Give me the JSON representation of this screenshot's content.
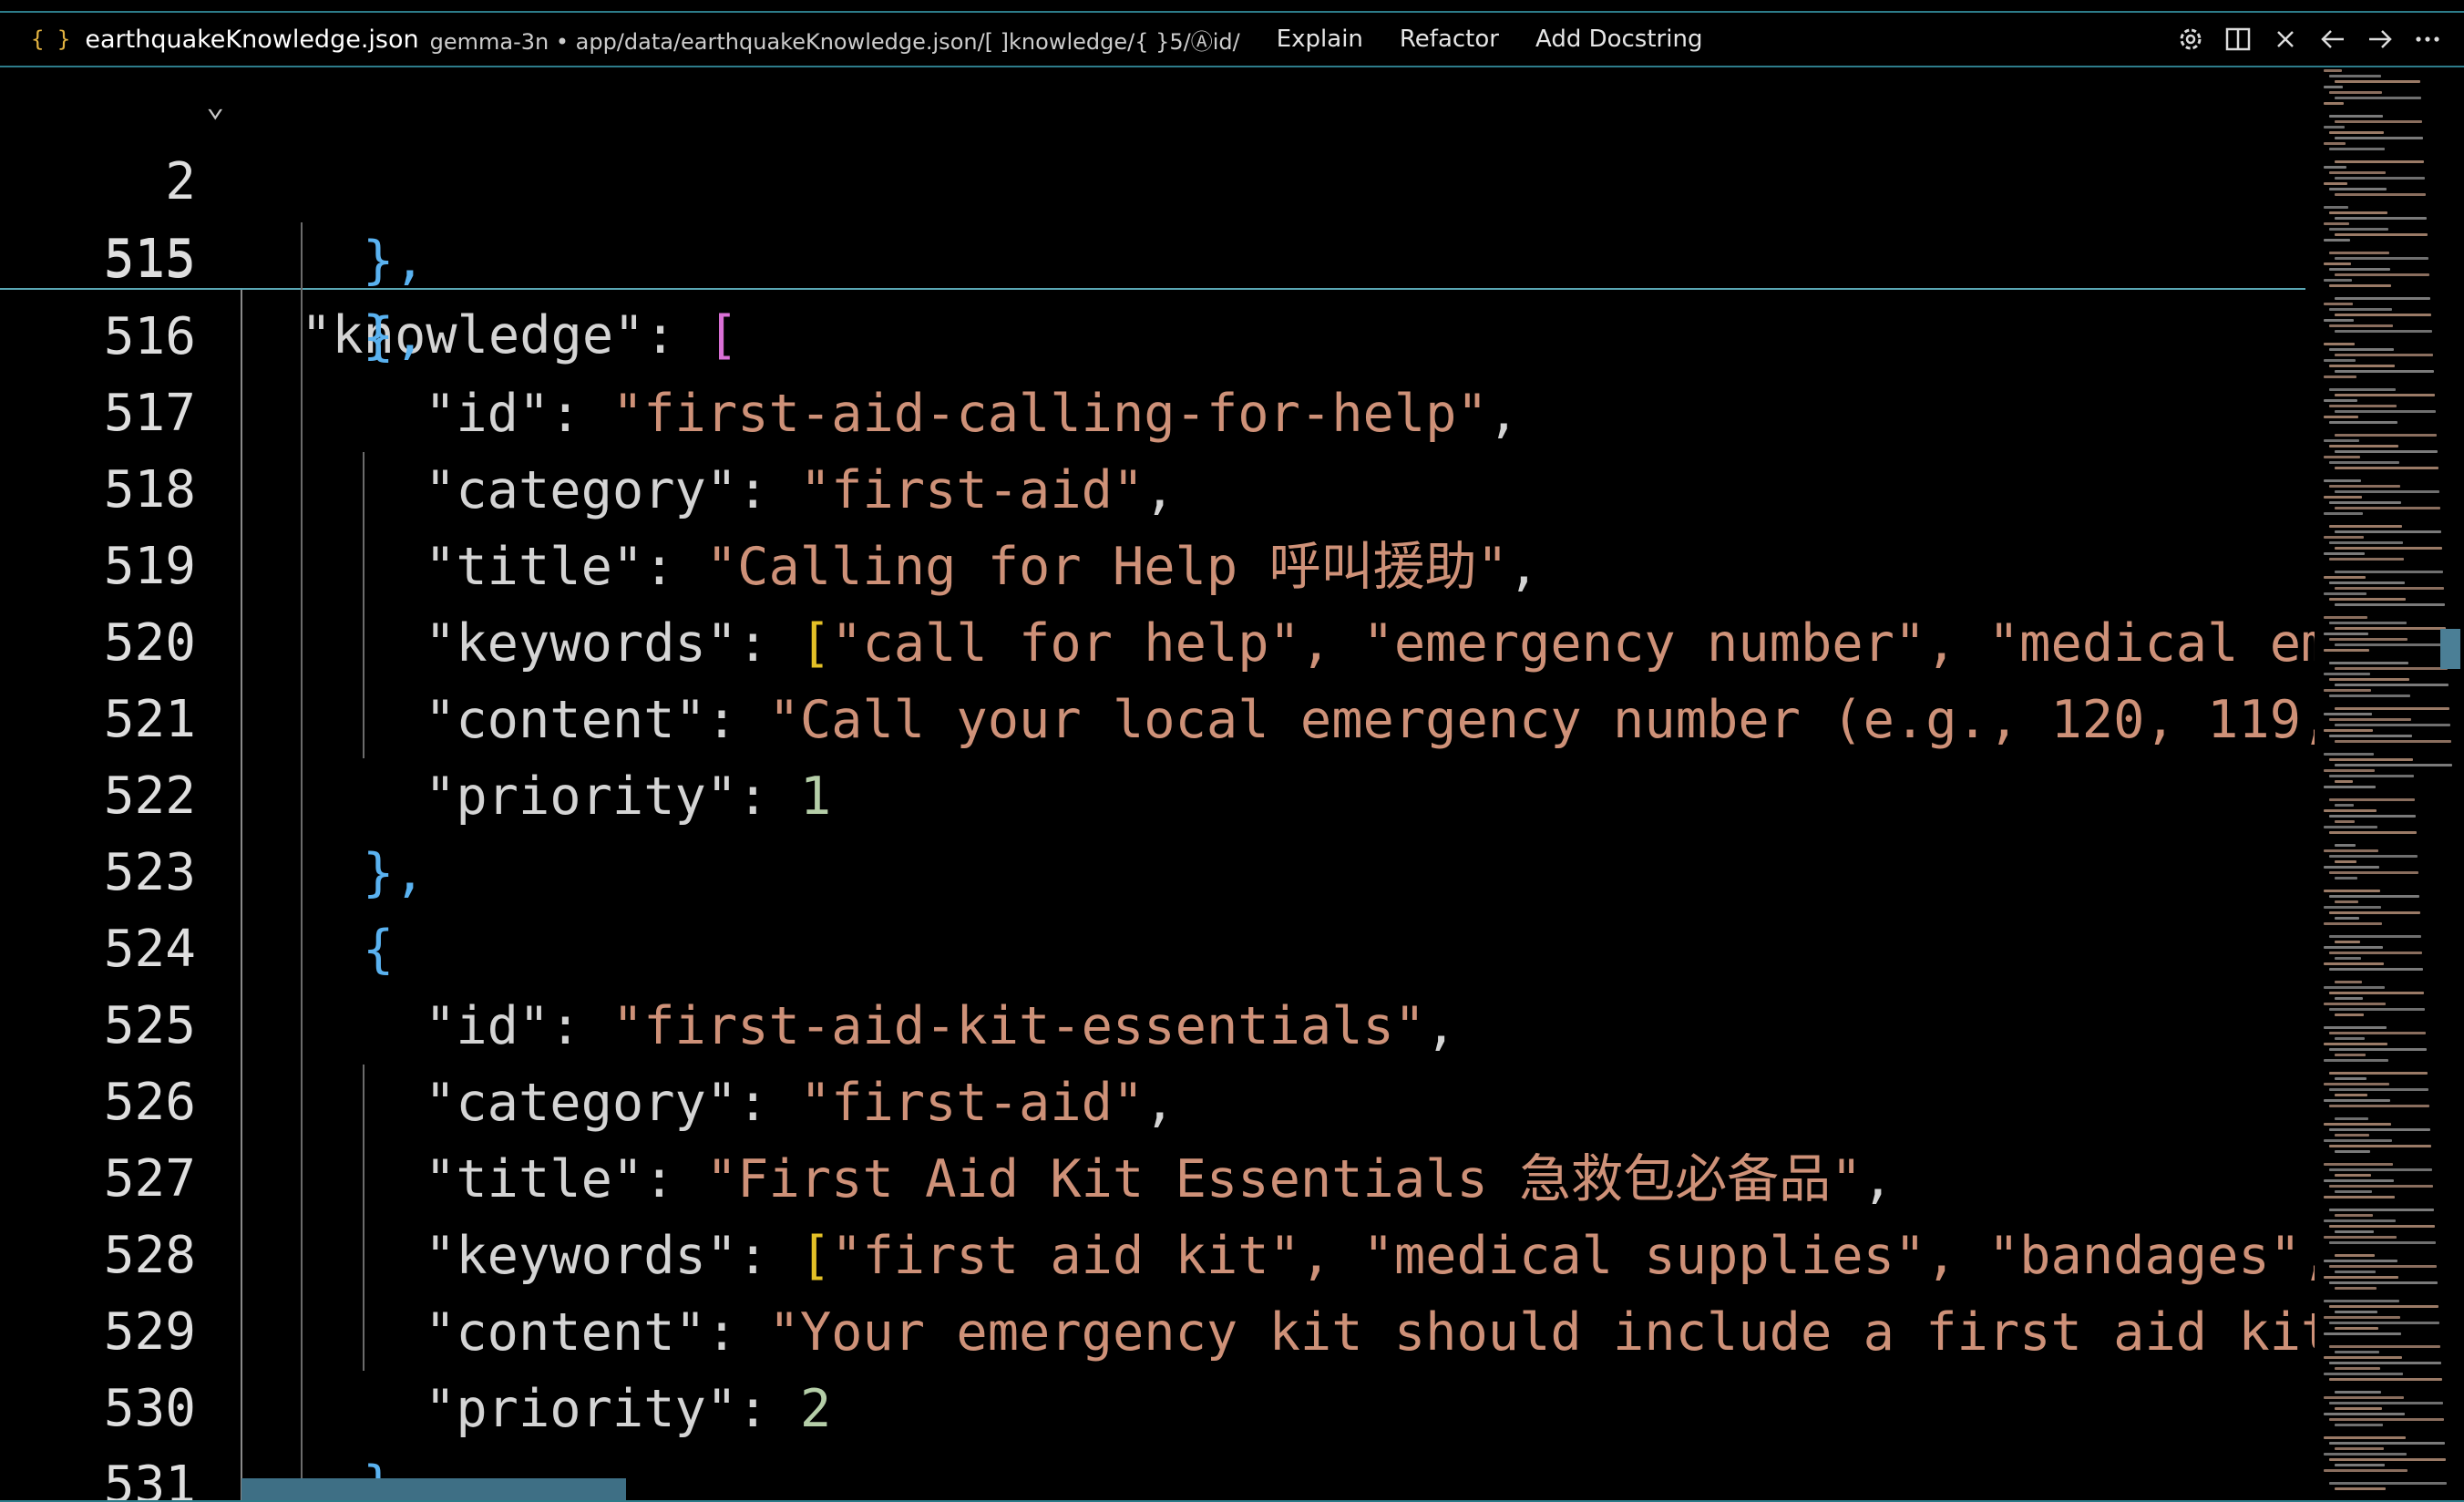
{
  "tab": {
    "icon": "{ }",
    "file_name": "earthquakeKnowledge.json",
    "breadcrumb": "gemma-3n • app/data/earthquakeKnowledge.json/[ ]knowledge/{ }5/Ⓐid/"
  },
  "actions": [
    "Explain",
    "Refactor",
    "Add Docstring"
  ],
  "toolbar_icons": [
    "settings-icon",
    "split-editor-icon",
    "close-icon",
    "arrow-left-icon",
    "arrow-right-icon",
    "more-icon"
  ],
  "sticky": [
    {
      "num": "2",
      "key": "\"knowledge\"",
      "open": "["
    },
    {
      "num": "515",
      "text": "},"
    }
  ],
  "lines": [
    {
      "num": "515",
      "text": "},",
      "indent": 1
    },
    {
      "num": "516",
      "text": "{",
      "indent": 1
    },
    {
      "num": "517",
      "key": "\"id\"",
      "value": "\"first-aid-calling-for-help\"",
      "trail": ",",
      "indent": 2
    },
    {
      "num": "518",
      "key": "\"category\"",
      "value": "\"first-aid\"",
      "trail": ",",
      "indent": 2
    },
    {
      "num": "519",
      "key": "\"title\"",
      "value": "\"Calling for Help 呼叫援助\"",
      "trail": ",",
      "indent": 2
    },
    {
      "num": "520",
      "key": "\"keywords\"",
      "value": "\"call for help\", \"emergency number\", \"medical eme",
      "open": "[",
      "trail": "",
      "indent": 2
    },
    {
      "num": "521",
      "key": "\"content\"",
      "value": "\"Call your local emergency number (e.g., 120, 119,",
      "trail": "",
      "indent": 2
    },
    {
      "num": "522",
      "key": "\"priority\"",
      "number": "1",
      "indent": 2
    },
    {
      "num": "523",
      "text": "},",
      "indent": 1
    },
    {
      "num": "524",
      "text": "{",
      "indent": 1
    },
    {
      "num": "525",
      "key": "\"id\"",
      "value": "\"first-aid-kit-essentials\"",
      "trail": ",",
      "indent": 2
    },
    {
      "num": "526",
      "key": "\"category\"",
      "value": "\"first-aid\"",
      "trail": ",",
      "indent": 2
    },
    {
      "num": "527",
      "key": "\"title\"",
      "value": "\"First Aid Kit Essentials 急救包必备品\"",
      "trail": ",",
      "indent": 2
    },
    {
      "num": "528",
      "key": "\"keywords\"",
      "value": "\"first aid kit\", \"medical supplies\", \"bandages\",",
      "open": "[",
      "trail": "",
      "indent": 2
    },
    {
      "num": "529",
      "key": "\"content\"",
      "value": "\"Your emergency kit should include a first aid kit",
      "trail": "",
      "indent": 2
    },
    {
      "num": "530",
      "key": "\"priority\"",
      "number": "2",
      "indent": 2
    },
    {
      "num": "531",
      "text": "},",
      "indent": 1
    }
  ],
  "colors": {
    "string": "#ce9178",
    "number": "#b5cea8",
    "bracket_gold": "#e3c026",
    "bracket_magenta": "#da70d6",
    "brace_blue": "#5ab2f0",
    "accent_border": "#2d7c8a"
  }
}
